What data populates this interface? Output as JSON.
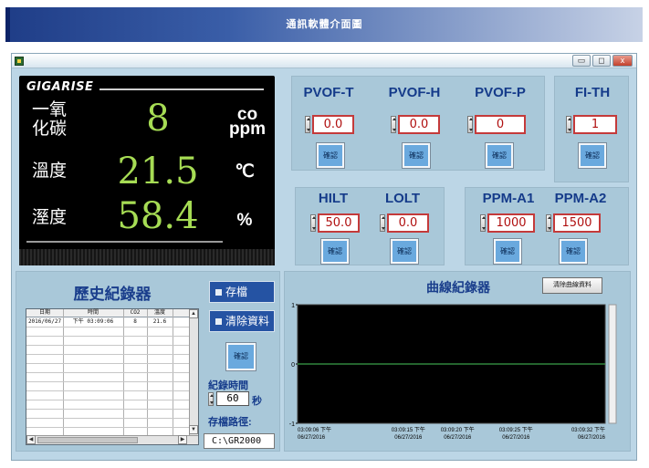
{
  "banner": {
    "title": "通訊軟體介面圖"
  },
  "window": {
    "controls": {
      "minimize": "▭",
      "maximize": "◻",
      "close": "x"
    }
  },
  "display": {
    "logo": "GIGARISE",
    "rows": [
      {
        "label_line1": "一氧",
        "label_line2": "化碳",
        "value": "8",
        "unit_line1": "co",
        "unit_line2": "ppm"
      },
      {
        "label": "溫度",
        "value": "21.5",
        "unit": "℃"
      },
      {
        "label": "溼度",
        "value": "58.4",
        "unit": "%"
      }
    ]
  },
  "params": {
    "pvof_t": {
      "label": "PVOF-T",
      "value": "0.0"
    },
    "pvof_h": {
      "label": "PVOF-H",
      "value": "0.0"
    },
    "pvof_p": {
      "label": "PVOF-P",
      "value": "0"
    },
    "fi_th": {
      "label": "FI-TH",
      "value": "1"
    },
    "hilt": {
      "label": "HILT",
      "value": "50.0"
    },
    "lolt": {
      "label": "LOLT",
      "value": "0.0"
    },
    "ppm_a1": {
      "label": "PPM-A1",
      "value": "1000"
    },
    "ppm_a2": {
      "label": "PPM-A2",
      "value": "1500"
    },
    "confirm_label": "確認"
  },
  "history": {
    "title": "歷史紀錄器",
    "columns": [
      "日期",
      "時間",
      "CO2",
      "溫度"
    ],
    "rows": [
      [
        "2016/06/27",
        "下午 03:09:06",
        "8",
        "21.6"
      ]
    ],
    "save_label": "存檔",
    "clear_label": "清除資料",
    "confirm_label": "確認",
    "interval_label": "紀錄時間",
    "interval_value": "60",
    "interval_unit": "秒",
    "path_label": "存檔路徑:",
    "path_value": "C:\\GR2000"
  },
  "chart": {
    "title": "曲線紀錄器",
    "clear_label": "清除曲線資料"
  },
  "chart_data": {
    "type": "line",
    "title": "曲線紀錄器",
    "ylim": [
      -1,
      1
    ],
    "yticks": [
      "1",
      "0",
      "-1"
    ],
    "xticks": [
      {
        "time": "03:09:06 下午",
        "date": "06/27/2016"
      },
      {
        "time": "03:09:15 下午",
        "date": "06/27/2016"
      },
      {
        "time": "03:09:20 下午",
        "date": "06/27/2016"
      },
      {
        "time": "03:09:25 下午",
        "date": "06/27/2016"
      },
      {
        "time": "03:09:32 下午",
        "date": "06/27/2016"
      }
    ],
    "series": [
      {
        "color": "#3aa04a",
        "values": [
          0,
          0,
          0,
          0,
          0
        ]
      }
    ],
    "background": "#000000"
  }
}
